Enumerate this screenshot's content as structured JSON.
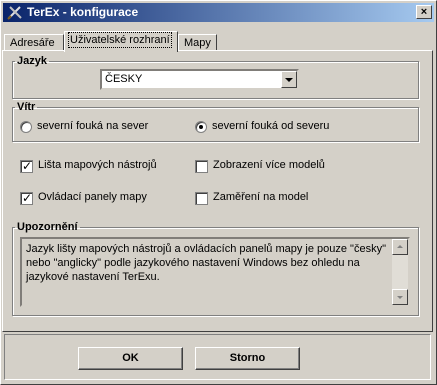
{
  "window": {
    "title": "TerEx - konfigurace"
  },
  "tabs": [
    {
      "label": "Adresáře",
      "active": false
    },
    {
      "label": "Uživatelské rozhraní",
      "active": true
    },
    {
      "label": "Mapy",
      "active": false
    }
  ],
  "language_group": {
    "title": "Jazyk",
    "selected": "ČESKY"
  },
  "wind_group": {
    "title": "Vítr",
    "options": [
      {
        "label": "severní fouká na sever",
        "checked": false
      },
      {
        "label": "severní fouká od severu",
        "checked": true
      }
    ]
  },
  "checkboxes": [
    {
      "label": "Lišta mapových nástrojů",
      "checked": true
    },
    {
      "label": "Zobrazení více modelů",
      "checked": false
    },
    {
      "label": "Ovládací panely mapy",
      "checked": true
    },
    {
      "label": "Zaměření na model",
      "checked": false
    }
  ],
  "notice_group": {
    "title": "Upozornění",
    "text": "Jazyk lišty mapových nástrojů a ovládacích panelů mapy je pouze \"česky\" nebo \"anglicky\" podle jazykového nastavení Windows bez ohledu na jazykové nastavení TerExu."
  },
  "buttons": {
    "ok": "OK",
    "cancel": "Storno"
  }
}
